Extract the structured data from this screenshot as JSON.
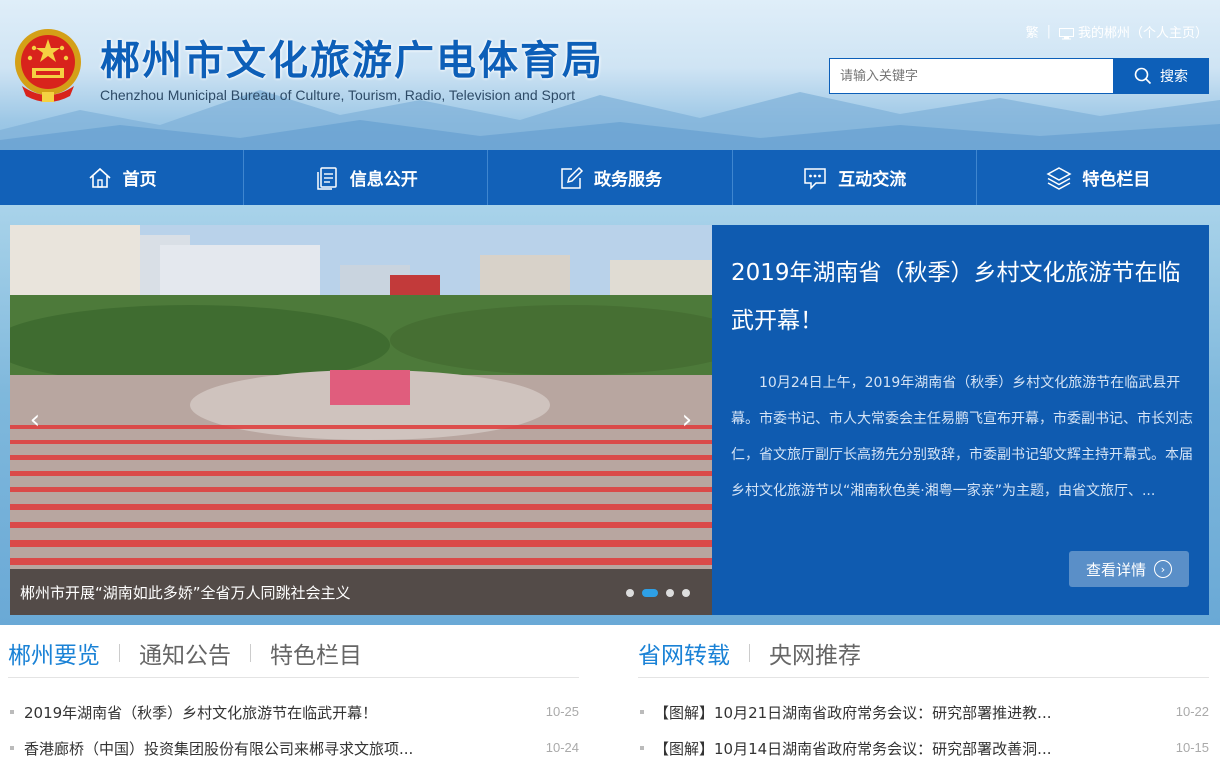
{
  "header": {
    "title": "郴州市文化旅游广电体育局",
    "subtitle": "Chenzhou Municipal Bureau of Culture, Tourism, Radio, Television and Sport",
    "lang_toggle": "繁",
    "my_chenzhou": "我的郴州（个人主页）",
    "search_placeholder": "请输入关键字",
    "search_button": "搜索"
  },
  "nav": [
    {
      "label": "首页",
      "icon": "home-icon"
    },
    {
      "label": "信息公开",
      "icon": "document-icon"
    },
    {
      "label": "政务服务",
      "icon": "edit-icon"
    },
    {
      "label": "互动交流",
      "icon": "chat-icon"
    },
    {
      "label": "特色栏目",
      "icon": "layers-icon"
    }
  ],
  "slider": {
    "caption": "郴州市开展“湖南如此多娇”全省万人同跳社会主义",
    "active_dot": 1,
    "dot_count": 4,
    "prev": "‹",
    "next": "›"
  },
  "feature": {
    "title": "2019年湖南省（秋季）乡村文化旅游节在临武开幕！",
    "summary": "10月24日上午，2019年湖南省（秋季）乡村文化旅游节在临武县开幕。市委书记、市人大常委会主任易鹏飞宣布开幕，市委副书记、市长刘志仁，省文旅厅副厅长高扬先分别致辞，市委副书记邹文辉主持开幕式。本届乡村文化旅游节以“湘南秋色美·湘粤一家亲”为主题，由省文旅厅、...",
    "detail_button": "查看详情"
  },
  "left_section": {
    "tabs": [
      "郴州要览",
      "通知公告",
      "特色栏目"
    ],
    "active_tab": 0,
    "items": [
      {
        "title": "2019年湖南省（秋季）乡村文化旅游节在临武开幕！",
        "date": "10-25"
      },
      {
        "title": "香港廊桥（中国）投资集团股份有限公司来郴寻求文旅项...",
        "date": "10-24"
      }
    ]
  },
  "right_section": {
    "tabs": [
      "省网转载",
      "央网推荐"
    ],
    "active_tab": 0,
    "items": [
      {
        "title": "【图解】10月21日湖南省政府常务会议：研究部署推进教...",
        "date": "10-22"
      },
      {
        "title": "【图解】10月14日湖南省政府常务会议：研究部署改善洞...",
        "date": "10-15"
      }
    ]
  },
  "colors": {
    "primary": "#0d5fb8",
    "nav": "#1261b8",
    "accent_tab": "#1a82d6",
    "feature_bg": "#0f5bb0"
  }
}
